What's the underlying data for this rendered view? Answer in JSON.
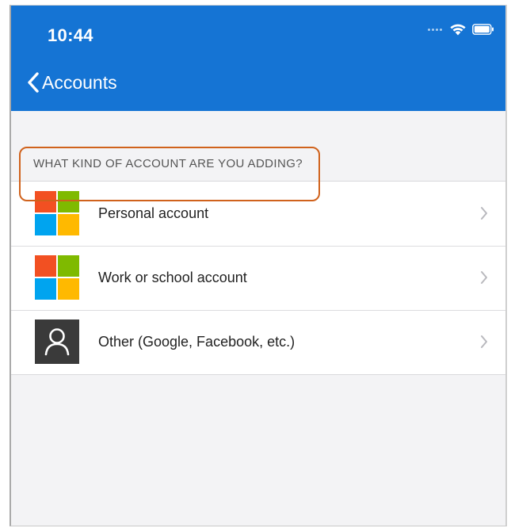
{
  "status_bar": {
    "time": "10:44",
    "icons": [
      "signal-dots-icon",
      "wifi-icon",
      "battery-icon"
    ]
  },
  "nav": {
    "back_label": "Accounts",
    "back_icon": "chevron-left-icon",
    "background_color": "#1574d4"
  },
  "section_header": "WHAT KIND OF ACCOUNT ARE YOU ADDING?",
  "accounts": [
    {
      "label": "Personal account",
      "icon": "microsoft-logo-icon"
    },
    {
      "label": "Work or school account",
      "icon": "microsoft-logo-icon",
      "highlighted": true
    },
    {
      "label": "Other (Google, Facebook, etc.)",
      "icon": "person-icon"
    }
  ],
  "colors": {
    "highlight": "#d0621c",
    "ms_red": "#f25022",
    "ms_green": "#7fba00",
    "ms_blue": "#00a4ef",
    "ms_yellow": "#ffb900"
  }
}
